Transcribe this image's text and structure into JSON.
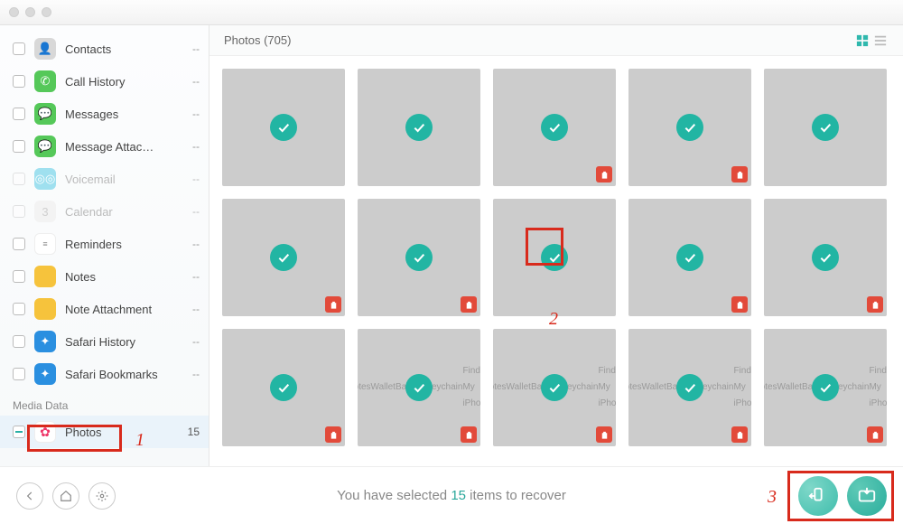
{
  "header": {
    "title": "Photos (705)"
  },
  "sidebar": {
    "items": [
      {
        "label": "Contacts",
        "count": "--",
        "icon_bg": "#d8d8d8"
      },
      {
        "label": "Call History",
        "count": "--",
        "icon_bg": "#55c859"
      },
      {
        "label": "Messages",
        "count": "--",
        "icon_bg": "#55c859"
      },
      {
        "label": "Message Attac…",
        "count": "--",
        "icon_bg": "#55c859"
      },
      {
        "label": "Voicemail",
        "count": "--",
        "icon_bg": "#58c8e2",
        "dim": true
      },
      {
        "label": "Calendar",
        "count": "--",
        "icon_bg": "#efefef",
        "dim": true
      },
      {
        "label": "Reminders",
        "count": "--",
        "icon_bg": "#ffffff"
      },
      {
        "label": "Notes",
        "count": "--",
        "icon_bg": "#f6c33c"
      },
      {
        "label": "Note Attachment",
        "count": "--",
        "icon_bg": "#f6c33c"
      },
      {
        "label": "Safari History",
        "count": "--",
        "icon_bg": "#2a8fe0"
      },
      {
        "label": "Safari Bookmarks",
        "count": "--",
        "icon_bg": "#2a8fe0"
      }
    ],
    "media_section_label": "Media Data",
    "photos": {
      "label": "Photos",
      "count": "15"
    }
  },
  "footer": {
    "selected_prefix": "You have selected ",
    "selected_count": "15",
    "selected_suffix": " items to recover"
  },
  "annotations": {
    "one": "1",
    "two": "2",
    "three": "3"
  },
  "screenshot_rows": [
    "Notes",
    "Wallet",
    "Backup",
    "Keychain",
    "Find My iPhone"
  ]
}
